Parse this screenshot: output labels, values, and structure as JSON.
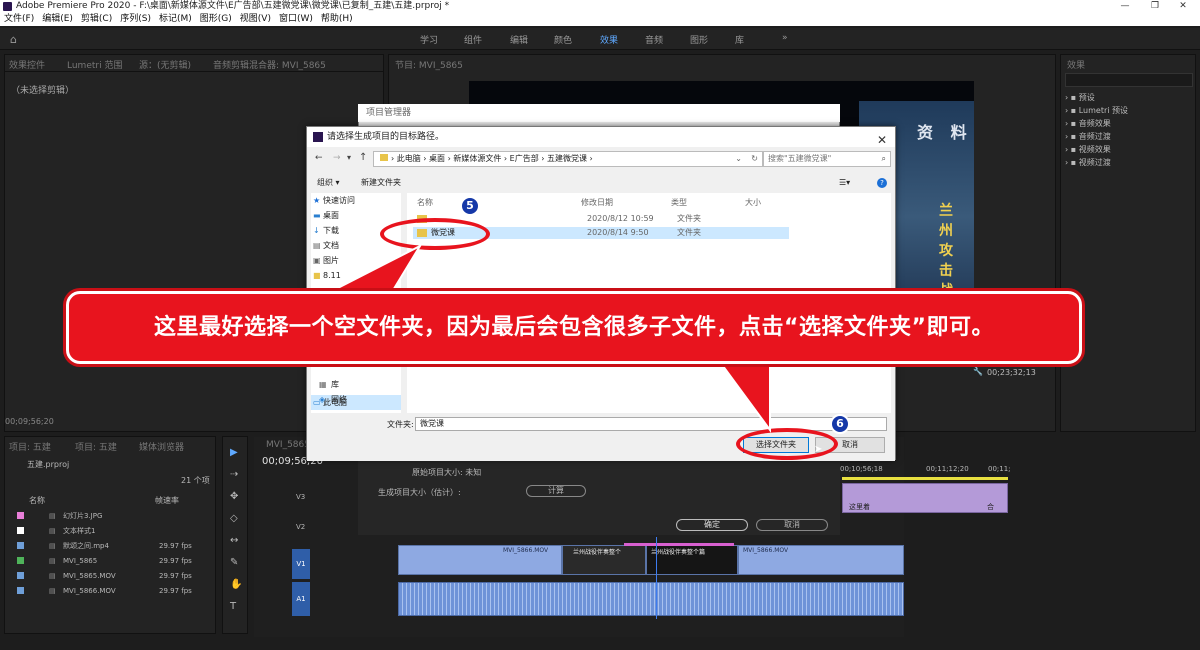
{
  "titlebar": {
    "title": "Adobe Premiere Pro 2020 - F:\\桌面\\新媒体源文件\\E广告部\\五建微党课\\微党课\\已复制_五建\\五建.prproj *",
    "minimize": "—",
    "maximize": "❐",
    "close": "✕"
  },
  "menu": [
    "文件(F)",
    "编辑(E)",
    "剪辑(C)",
    "序列(S)",
    "标记(M)",
    "图形(G)",
    "视图(V)",
    "窗口(W)",
    "帮助(H)"
  ],
  "workspaces": [
    "学习",
    "组件",
    "编辑",
    "颜色",
    "效果",
    "音频",
    "图形",
    "库"
  ],
  "workspace_active": "效果",
  "workspace_more": "»",
  "source_panel": {
    "tabs": [
      "效果控件",
      "Lumetri 范围",
      "源：(无剪辑)",
      "音频剪辑混合器: MVI_5865"
    ],
    "empty": "（未选择剪辑）",
    "timecode": "00;09;56;20"
  },
  "program_panel": {
    "tab": "节目: MVI_5865",
    "overlay_text": "资 料",
    "vertical_text": "兰州攻击战",
    "timecode": "00;23;32;13"
  },
  "effects_panel": {
    "tab": "效果",
    "items": [
      "预设",
      "Lumetri 预设",
      "音频效果",
      "音频过渡",
      "视频效果",
      "视频过渡"
    ]
  },
  "project_panel": {
    "tabs": [
      "项目: 五建",
      "项目: 五建",
      "媒体浏览器"
    ],
    "name": "五建.prproj",
    "count": "21 个项",
    "col_name": "名称",
    "col_fps": "帧速率",
    "items": [
      {
        "name": "幻灯片3.JPG",
        "fps": "",
        "color": "#e87fd8"
      },
      {
        "name": "文本样式1",
        "fps": "",
        "color": "#ffffff"
      },
      {
        "name": "默颂之间.mp4",
        "fps": "29.97 fps",
        "color": "#6f9fd8"
      },
      {
        "name": "MVI_5865",
        "fps": "29.97 fps",
        "color": "#4fb35a"
      },
      {
        "name": "MVI_5865.MOV",
        "fps": "29.97 fps",
        "color": "#6f9fd8"
      },
      {
        "name": "MVI_5866.MOV",
        "fps": "29.97 fps",
        "color": "#6f9fd8"
      }
    ]
  },
  "timeline": {
    "tab": "MVI_5865",
    "timecode": "00;09;56;20",
    "ruler": [
      "00;10;56;18",
      "00;11;12;20",
      "00;11;"
    ],
    "tracks": [
      "V3",
      "V2",
      "V1",
      "A1"
    ],
    "v1_clips": [
      "MVI_5866.MOV",
      "兰州战役伴奏整个",
      "兰州战役伴奏整个篇",
      "MVI_5866.MOV"
    ],
    "upper_clips": [
      "这里着",
      "合"
    ]
  },
  "project_manager": {
    "title": "项目管理器",
    "original_size_label": "原始项目大小: 未知",
    "est_size_label": "生成项目大小（估计）:",
    "calc_button": "计算",
    "ok_button": "确定",
    "cancel_button": "取消"
  },
  "folder_dialog": {
    "title": "请选择生成项目的目标路径。",
    "close": "✕",
    "breadcrumb": [
      "此电脑",
      "桌面",
      "新媒体源文件",
      "E广告部",
      "五建微党课"
    ],
    "search_placeholder": "搜索\"五建微党课\"",
    "organize": "组织 ▾",
    "new_folder": "新建文件夹",
    "nav_items": [
      "快速访问",
      "桌面",
      "下载",
      "文档",
      "图片",
      "8.11",
      "此电脑",
      "库",
      "网络"
    ],
    "col_name": "名称",
    "col_date": "修改日期",
    "col_type": "类型",
    "col_size": "大小",
    "files": [
      {
        "name": "",
        "date": "2020/8/12 10:59",
        "type": "文件夹"
      },
      {
        "name": "微党课",
        "date": "2020/8/14 9:50",
        "type": "文件夹"
      }
    ],
    "folder_label": "文件夹:",
    "folder_value": "微党课",
    "select_button": "选择文件夹",
    "cancel_button": "取消"
  },
  "annotations": {
    "badge_5": "5",
    "badge_6": "6",
    "callout": "这里最好选择一个空文件夹，因为最后会包含很多子文件，点击“选择文件夹”即可。"
  }
}
